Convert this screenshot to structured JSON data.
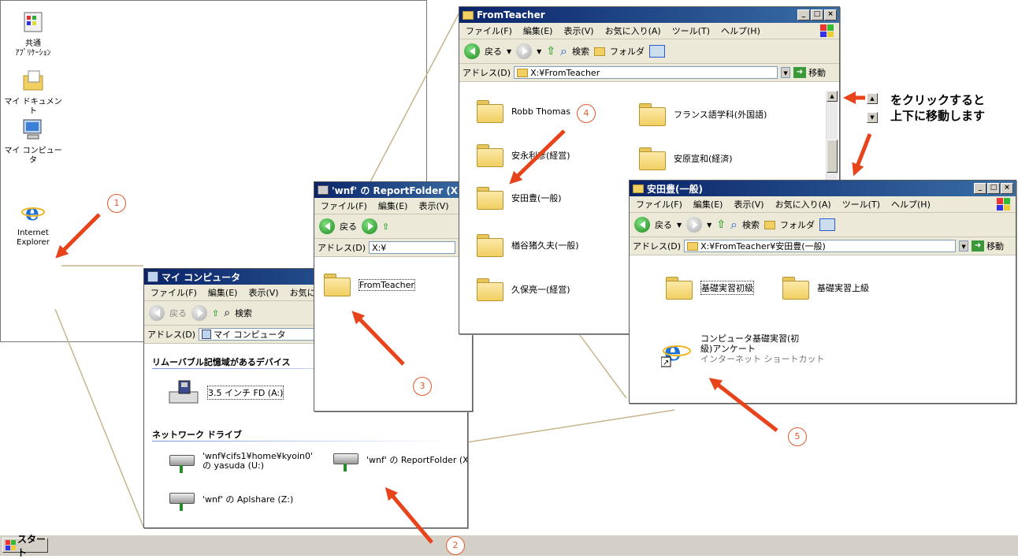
{
  "desktop": {
    "icons": [
      {
        "label": "共通\nｱﾌﾟﾘｹｰｼｮﾝ"
      },
      {
        "label": "マイ ドキュメント"
      },
      {
        "label": "マイ コンピュータ"
      },
      {
        "label": "Internet\nExplorer"
      }
    ],
    "start_label": "スタート"
  },
  "my_computer": {
    "title": "マイ コンピュータ",
    "menu": [
      "ファイル(F)",
      "編集(E)",
      "表示(V)",
      "お気に"
    ],
    "toolbar": {
      "back": "戻る",
      "search": "検索"
    },
    "address_label": "アドレス(D)",
    "address_value": "マイ コンピュータ",
    "section_removable": "リムーバブル記憶域があるデバイス",
    "floppy": "3.5 インチ FD (A:)",
    "section_network": "ネットワーク ドライブ",
    "drives": [
      "'wnf¥cifs1¥home¥kyoin0' の yasuda (U:)",
      "'wnf' の ReportFolder (X:)",
      "'wnf' の Aplshare (Z:)"
    ]
  },
  "report_folder": {
    "title": "'wnf' の ReportFolder (X:)",
    "menu": [
      "ファイル(F)",
      "編集(E)",
      "表示(V)"
    ],
    "toolbar": {
      "back": "戻る"
    },
    "address_label": "アドレス(D)",
    "address_value": "X:¥",
    "folder": "FromTeacher"
  },
  "from_teacher": {
    "title": "FromTeacher",
    "menu": [
      "ファイル(F)",
      "編集(E)",
      "表示(V)",
      "お気に入り(A)",
      "ツール(T)",
      "ヘルプ(H)"
    ],
    "toolbar": {
      "back": "戻る",
      "search": "検索",
      "folders": "フォルダ"
    },
    "address_label": "アドレス(D)",
    "address_value": "X:¥FromTeacher",
    "go": "移動",
    "folders": [
      "Robb Thomas",
      "フランス語学科(外国語)",
      "安永利彦(経営)",
      "安原宣和(経済)",
      "安田豊(一般)",
      "楢谷猪久夫(一般)",
      "久保亮一(経営)"
    ]
  },
  "yasuda": {
    "title": "安田豊(一般)",
    "menu": [
      "ファイル(F)",
      "編集(E)",
      "表示(V)",
      "お気に入り(A)",
      "ツール(T)",
      "ヘルプ(H)"
    ],
    "toolbar": {
      "back": "戻る",
      "search": "検索",
      "folders": "フォルダ"
    },
    "address_label": "アドレス(D)",
    "address_value": "X:¥FromTeacher¥安田豊(一般)",
    "go": "移動",
    "folders": [
      "基礎実習初級",
      "基礎実習上級"
    ],
    "shortcut_name": "コンピュータ基礎実習(初級)アンケート",
    "shortcut_type": "インターネット ショートカット"
  },
  "annotation": {
    "note_line1": "をクリックすると",
    "note_line2": "上下に移動します",
    "steps": [
      "1",
      "2",
      "3",
      "4",
      "5"
    ]
  },
  "colors": {
    "arrow": "#e8441c",
    "title_start": "#0a246a",
    "title_end": "#3a6ea5"
  }
}
